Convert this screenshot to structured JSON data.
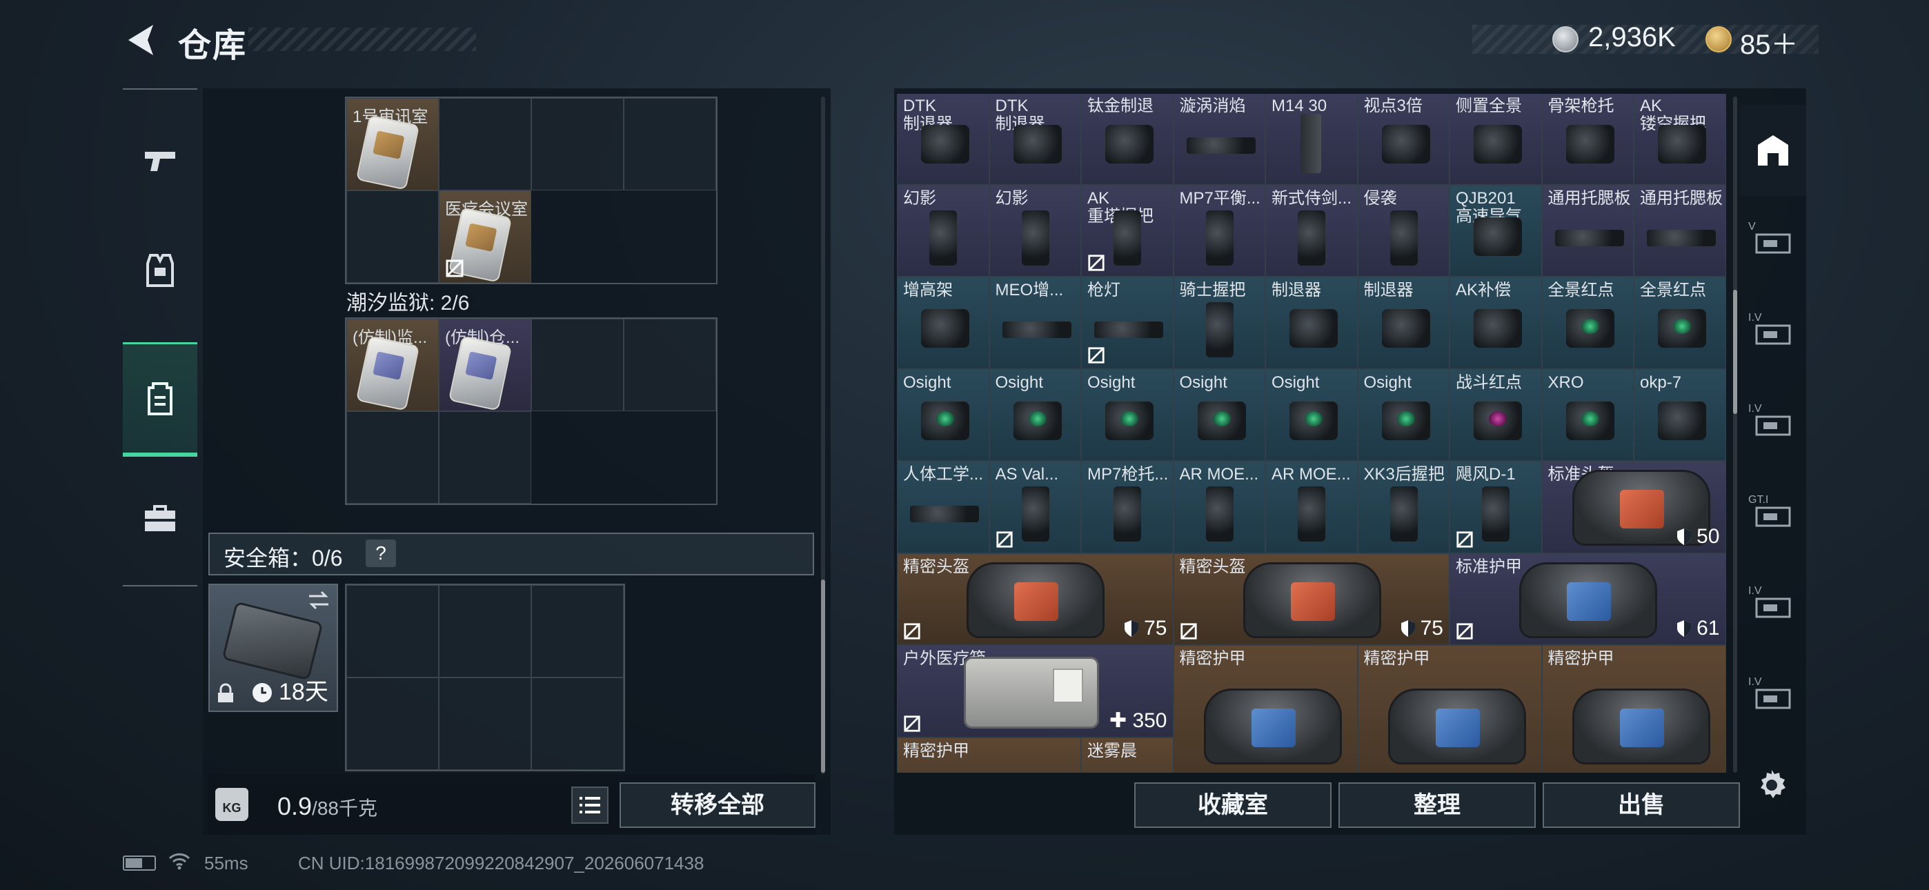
{
  "header": {
    "title": "仓库",
    "coins": "2,936K",
    "tickets": "85＋"
  },
  "backpack": {
    "grid1_items": [
      {
        "label": "1号审讯室"
      },
      {
        "label": "医疗会议室"
      }
    ],
    "zone_title": "潮汐监狱: 2/6",
    "grid2_items": [
      {
        "label": "(仿制)监..."
      },
      {
        "label": "(仿制)仓..."
      }
    ],
    "safe_box_label": "安全箱：0/6",
    "safe_help": "?",
    "case_days": "18天",
    "weight_value": "0.9",
    "weight_capacity": "/88千克",
    "kg_icon_text": "KG",
    "transfer_all": "转移全部"
  },
  "stash": {
    "rows": [
      [
        {
          "name": "DTK\n制退器",
          "bg": "purple",
          "icon": "part",
          "ni": false
        },
        {
          "name": "DTK\n制退器",
          "bg": "purple",
          "icon": "part",
          "ni": false
        },
        {
          "name": "钛金制退",
          "bg": "purple",
          "icon": "part",
          "ni": false
        },
        {
          "name": "漩涡消焰",
          "bg": "purple",
          "icon": "long",
          "ni": false
        },
        {
          "name": "M14 30",
          "bg": "purple",
          "icon": "mag",
          "ni": false
        },
        {
          "name": "视点3倍",
          "bg": "purple",
          "icon": "part",
          "ni": false
        },
        {
          "name": "侧置全景",
          "bg": "purple",
          "icon": "part",
          "ni": false
        },
        {
          "name": "骨架枪托",
          "bg": "purple",
          "icon": "part",
          "ni": false
        },
        {
          "name": "AK\n镂空握把",
          "bg": "purple",
          "icon": "part",
          "ni": false
        }
      ],
      [
        {
          "name": "幻影",
          "bg": "purple",
          "icon": "tall",
          "ni": false
        },
        {
          "name": "幻影",
          "bg": "purple",
          "icon": "tall",
          "ni": false
        },
        {
          "name": "AK\n重塔握把",
          "bg": "purple",
          "icon": "tall",
          "ni": true
        },
        {
          "name": "MP7平衡...",
          "bg": "purple",
          "icon": "tall",
          "ni": false
        },
        {
          "name": "新式侍剑...",
          "bg": "purple",
          "icon": "tall",
          "ni": false
        },
        {
          "name": "侵袭",
          "bg": "purple",
          "icon": "tall",
          "ni": false
        },
        {
          "name": "QJB201\n高速导气",
          "bg": "teal",
          "icon": "part",
          "ni": false
        },
        {
          "name": "通用托腮板",
          "bg": "purple",
          "icon": "long",
          "ni": false
        },
        {
          "name": "通用托腮板",
          "bg": "purple",
          "icon": "long",
          "ni": false
        }
      ],
      [
        {
          "name": "增高架",
          "bg": "teal",
          "icon": "part",
          "ni": false
        },
        {
          "name": "MEO增...",
          "bg": "teal",
          "icon": "long",
          "ni": false
        },
        {
          "name": "枪灯",
          "bg": "teal",
          "icon": "long",
          "ni": true
        },
        {
          "name": "骑士握把",
          "bg": "teal",
          "icon": "tall",
          "ni": false
        },
        {
          "name": "制退器",
          "bg": "teal",
          "icon": "part",
          "ni": false
        },
        {
          "name": "制退器",
          "bg": "teal",
          "icon": "part",
          "ni": false
        },
        {
          "name": "AK补偿",
          "bg": "teal",
          "icon": "part",
          "ni": false
        },
        {
          "name": "全景红点",
          "bg": "teal",
          "icon": "sight",
          "ni": false
        },
        {
          "name": "全景红点",
          "bg": "teal",
          "icon": "sight",
          "ni": false
        }
      ],
      [
        {
          "name": "Osight",
          "bg": "teal",
          "icon": "sight",
          "ni": false
        },
        {
          "name": "Osight",
          "bg": "teal",
          "icon": "sight",
          "ni": false
        },
        {
          "name": "Osight",
          "bg": "teal",
          "icon": "sight",
          "ni": false
        },
        {
          "name": "Osight",
          "bg": "teal",
          "icon": "sight",
          "ni": false
        },
        {
          "name": "Osight",
          "bg": "teal",
          "icon": "sight",
          "ni": false
        },
        {
          "name": "Osight",
          "bg": "teal",
          "icon": "sight",
          "ni": false
        },
        {
          "name": "战斗红点",
          "bg": "teal",
          "icon": "sight-red",
          "ni": false
        },
        {
          "name": "XRO",
          "bg": "teal",
          "icon": "sight",
          "ni": false
        },
        {
          "name": "okp-7",
          "bg": "teal",
          "icon": "part",
          "ni": false
        }
      ],
      [
        {
          "name": "人体工学...",
          "bg": "teal",
          "icon": "long",
          "ni": false
        },
        {
          "name": "AS Val...",
          "bg": "teal",
          "icon": "tall",
          "ni": true
        },
        {
          "name": "MP7枪托...",
          "bg": "teal",
          "icon": "tall",
          "ni": false
        },
        {
          "name": "AR MOE...",
          "bg": "teal",
          "icon": "tall",
          "ni": false
        },
        {
          "name": "AR MOE...",
          "bg": "teal",
          "icon": "tall",
          "ni": false
        },
        {
          "name": "XK3后握把",
          "bg": "teal",
          "icon": "tall",
          "ni": false
        },
        {
          "name": "飓风D-1",
          "bg": "teal",
          "icon": "tall",
          "ni": true
        }
      ]
    ],
    "big_items": [
      {
        "name": "标准头盔",
        "bg": "purple",
        "value": "50",
        "kind": "helmet",
        "patch": "orange",
        "ni": false
      },
      {
        "name": "精密头盔",
        "bg": "gold",
        "value": "75",
        "kind": "helmet",
        "patch": "orange",
        "ni": true
      },
      {
        "name": "精密头盔",
        "bg": "gold",
        "value": "75",
        "kind": "helmet",
        "patch": "orange",
        "ni": true
      },
      {
        "name": "标准护甲",
        "bg": "purple",
        "value": "61",
        "kind": "helmet",
        "patch": "blue",
        "ni": true
      },
      {
        "name": "户外医疗箱",
        "bg": "purple",
        "value": "350",
        "kind": "medkit",
        "ni": true
      },
      {
        "name": "精密护甲",
        "bg": "gold",
        "kind": "helmet",
        "patch": "blue"
      },
      {
        "name": "精密护甲",
        "bg": "gold",
        "kind": "helmet",
        "patch": "blue"
      },
      {
        "name": "精密护甲",
        "bg": "gold",
        "kind": "helmet",
        "patch": "blue"
      },
      {
        "name": "精密护甲",
        "bg": "gold"
      },
      {
        "name": "迷雾晨",
        "bg": "gold"
      }
    ],
    "buttons": {
      "collection": "收藏室",
      "sort": "整理",
      "sell": "出售"
    },
    "side_tabs": [
      "",
      "V",
      "I.V",
      "I.V",
      "GT.I",
      "I.V",
      "I.V"
    ]
  },
  "footer": {
    "ping": "55ms",
    "uid": "CN UID:18169987209922084290​7_202606071438"
  },
  "colors": {
    "accent": "#46d59f",
    "purple_rarity": "#3b3d5a",
    "teal_rarity": "#2a4a5a",
    "gold_rarity": "#5d4733"
  }
}
